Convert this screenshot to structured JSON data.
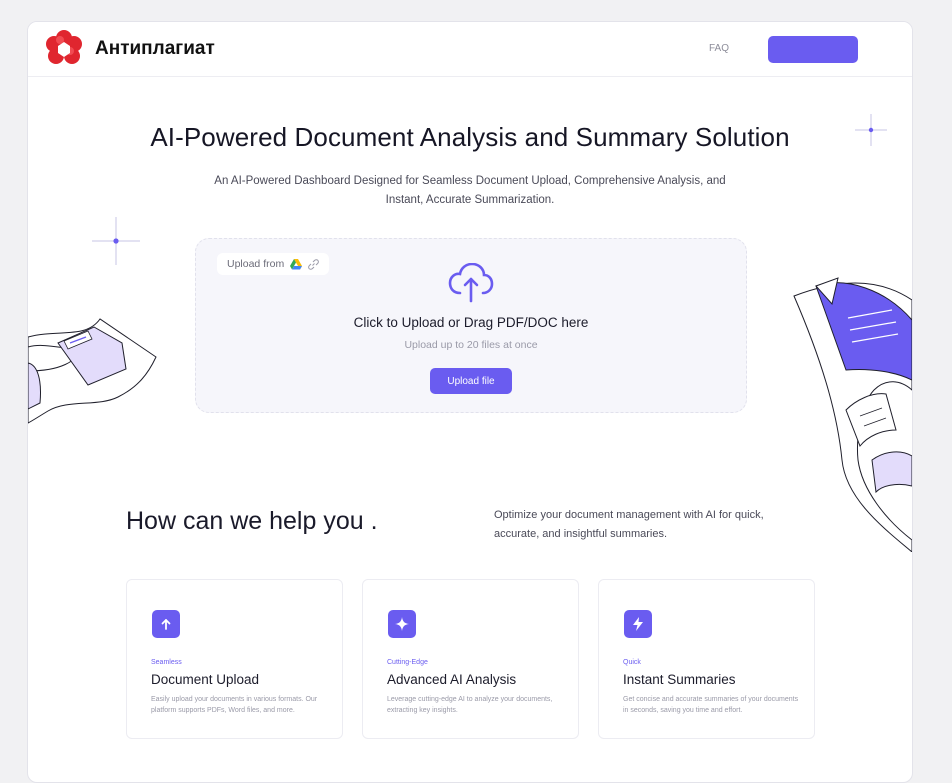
{
  "header": {
    "brand": "Антиплагиат",
    "faq": "FAQ",
    "cta_label": ""
  },
  "hero": {
    "title": "AI-Powered Document Analysis and Summary Solution",
    "subtitle": "An AI-Powered Dashboard Designed for Seamless Document Upload, Comprehensive Analysis, and Instant, Accurate Summarization."
  },
  "upload": {
    "from_label": "Upload from",
    "main_text": "Click to Upload or Drag PDF/DOC here",
    "hint": "Upload up to 20 files at once",
    "button": "Upload file"
  },
  "help": {
    "title": "How can we help you .",
    "subtitle": "Optimize your document management with AI for quick, accurate, and insightful summaries."
  },
  "cards": [
    {
      "icon": "folder-upload-icon",
      "tag": "Seamless",
      "title": "Document Upload",
      "desc": "Easily upload your documents in various formats. Our platform supports PDFs, Word files, and more."
    },
    {
      "icon": "sparkle-icon",
      "tag": "Cutting-Edge",
      "title": "Advanced AI Analysis",
      "desc": "Leverage cutting-edge AI to analyze your documents, extracting key insights."
    },
    {
      "icon": "lightning-icon",
      "tag": "Quick",
      "title": "Instant Summaries",
      "desc": "Get concise and accurate summaries of your documents in seconds, saving you time and effort."
    }
  ],
  "colors": {
    "accent": "#6a5cf0",
    "accent_light": "#e3dcfb",
    "logo_red": "#e0262f",
    "text_dark": "#161625",
    "text_muted": "#9a9aa8"
  }
}
